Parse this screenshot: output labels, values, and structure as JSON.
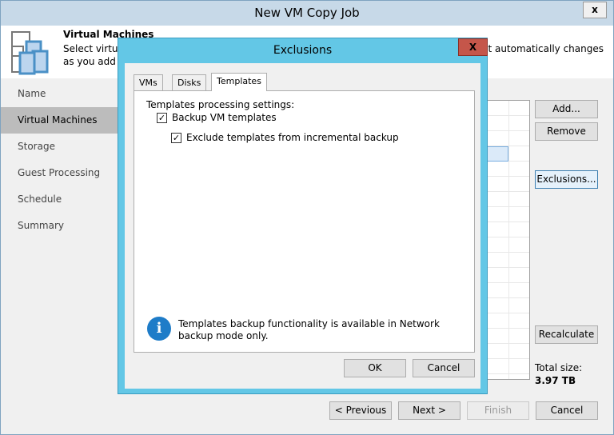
{
  "window": {
    "title": "New VM Copy Job",
    "close": "x"
  },
  "header": {
    "title": "Virtual Machines",
    "desc_left": "Select virtual",
    "desc_right": "hat automatically changes",
    "desc_line2": "as you add n"
  },
  "nav": [
    "Name",
    "Virtual Machines",
    "Storage",
    "Guest Processing",
    "Schedule",
    "Summary"
  ],
  "side_buttons": {
    "add": "Add...",
    "remove": "Remove",
    "exclusions": "Exclusions...",
    "recalculate": "Recalculate"
  },
  "total": {
    "label": "Total size:",
    "value": "3.97 TB"
  },
  "footer": {
    "previous": "< Previous",
    "next": "Next >",
    "finish": "Finish",
    "cancel": "Cancel"
  },
  "dialog": {
    "title": "Exclusions",
    "close": "X",
    "tabs": [
      "VMs",
      "Disks",
      "Templates"
    ],
    "settings_label": "Templates processing settings:",
    "backup_templates": "Backup VM templates",
    "exclude_incremental": "Exclude templates from incremental backup",
    "info": "Templates backup functionality is available in Network backup mode only.",
    "info_icon": "i",
    "ok": "OK",
    "cancel": "Cancel"
  }
}
